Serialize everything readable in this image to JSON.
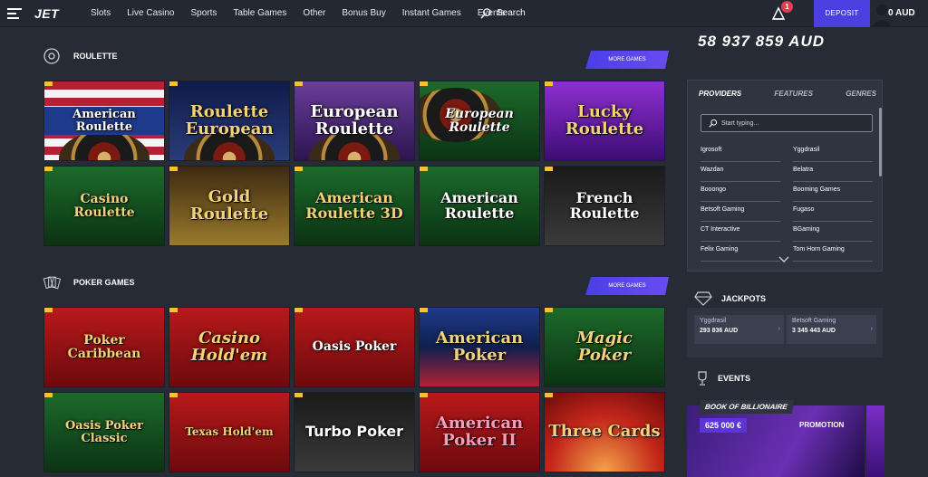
{
  "header": {
    "logo": "JET",
    "nav": [
      "Slots",
      "Live Casino",
      "Sports",
      "Table Games",
      "Other",
      "Bonus Buy",
      "Instant Games",
      "Events"
    ],
    "search_label": "Search",
    "notification_count": "1",
    "deposit_label": "DEPOSIT",
    "balance": "0 AUD"
  },
  "overlay_balance": "58 937 859 AUD",
  "sections": {
    "roulette": {
      "title": "ROULETTE",
      "more": "MORE GAMES",
      "games": [
        "American Roulette",
        "Roulette European",
        "European Roulette",
        "European Roulette",
        "Lucky Roulette",
        "Casino Roulette",
        "Gold Roulette",
        "American Roulette 3D",
        "American Roulette",
        "French Roulette"
      ]
    },
    "poker": {
      "title": "POKER GAMES",
      "more": "MORE GAMES",
      "games": [
        "Poker Caribbean",
        "Casino Hold'em",
        "Oasis Poker",
        "American Poker",
        "Magic Poker",
        "Oasis Poker Classic",
        "Texas Hold'em",
        "Turbo Poker",
        "American Poker II",
        "Three Cards"
      ]
    }
  },
  "providers_panel": {
    "tabs": [
      "PROVIDERS",
      "FEATURES",
      "GENRES"
    ],
    "search_placeholder": "Start typing...",
    "providers": [
      "Igrosoft",
      "Yggdrasil",
      "Wazdan",
      "Belatra",
      "Booongo",
      "Booming Games",
      "Betsoft Gaming",
      "Fugaso",
      "CT Interactive",
      "BGaming",
      "Felix Gaming",
      "Tom Horn Gaming"
    ]
  },
  "jackpots": {
    "title": "JACKPOTS",
    "items": [
      {
        "name": "Yggdrasil",
        "amount": "293 836 AUD"
      },
      {
        "name": "Betsoft Gaming",
        "amount": "3 345 443 AUD"
      }
    ]
  },
  "events": {
    "title": "EVENTS",
    "promo_title": "BOOK OF BILLIONAIRE",
    "promo_amount": "625 000 €",
    "promo_label": "PROMOTION"
  },
  "colors": {
    "accent": "#4c3fe0",
    "background": "#262b36",
    "panel": "#2f3441",
    "badge": "#e53d4f"
  }
}
